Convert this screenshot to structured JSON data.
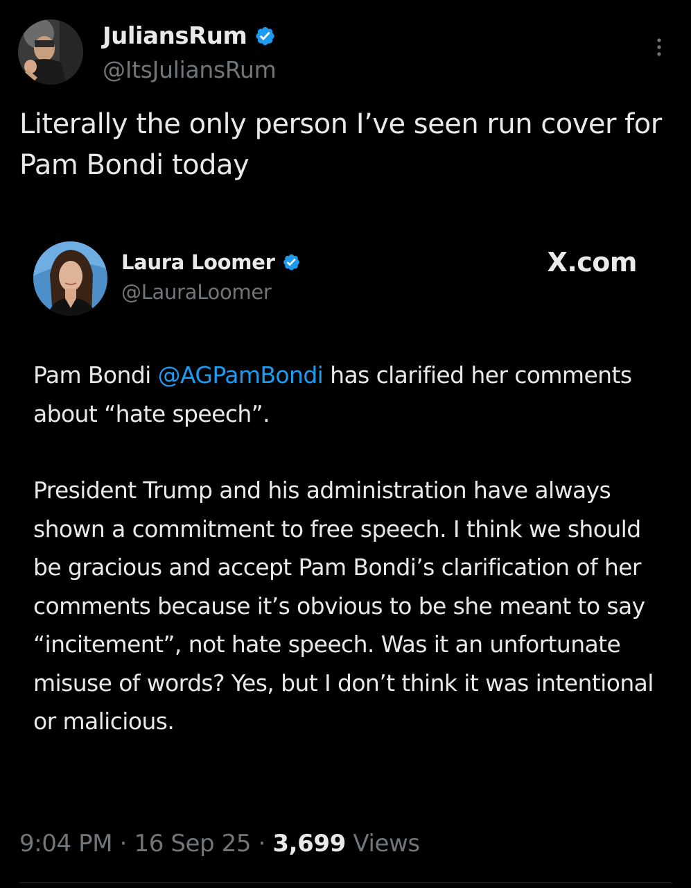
{
  "tweet": {
    "author": {
      "display_name": "JuliansRum",
      "handle": "@ItsJuliansRum",
      "verified": true,
      "avatar_icon": "profile-photo"
    },
    "more_icon": "more-vertical-icon",
    "text": "Literally the only person I’ve seen run cover for Pam Bondi today",
    "meta": {
      "time": "9:04 PM",
      "separator": "·",
      "date": "16 Sep 25",
      "views_count": "3,699",
      "views_label": "Views"
    }
  },
  "quoted": {
    "author": {
      "display_name": "Laura Loomer",
      "handle": "@LauraLoomer",
      "verified": true,
      "avatar_icon": "profile-photo"
    },
    "source": "X.com",
    "paragraph1": {
      "before": "Pam Bondi ",
      "mention": "@AGPamBondi",
      "after": " has clarified her comments about “hate speech”."
    },
    "paragraph2": "President Trump and his administration have always shown a commitment to free speech. I think we should be gracious and accept Pam Bondi’s clarification of her comments because it’s obvious to be she meant to say “incitement”, not hate speech. Was it an unfortunate misuse of words? Yes, but I don’t think it was intentional or malicious."
  },
  "colors": {
    "background": "#000000",
    "text": "#e7e9ea",
    "secondary": "#71767b",
    "link": "#1d9bf0",
    "verified_badge": "#1d9bf0"
  }
}
